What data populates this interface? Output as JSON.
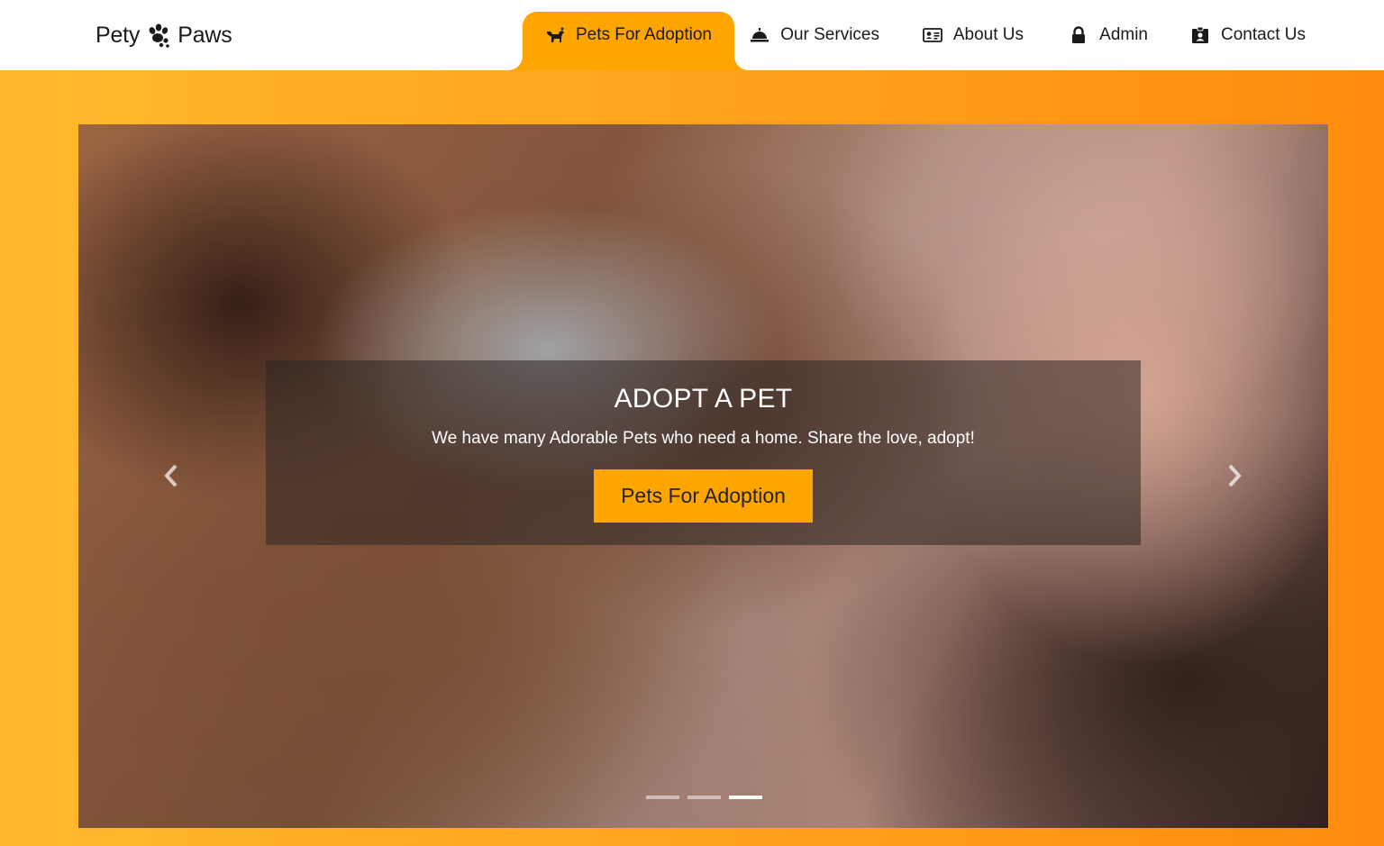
{
  "brand": {
    "name_left": "Pety",
    "name_right": "Paws",
    "icon": "paw-icon"
  },
  "nav": {
    "items": [
      {
        "label": "Pets For Adoption",
        "icon": "dog-icon",
        "active": true
      },
      {
        "label": "Our Services",
        "icon": "service-bell-icon",
        "active": false
      },
      {
        "label": "About Us",
        "icon": "id-card-icon",
        "active": false
      },
      {
        "label": "Admin",
        "icon": "lock-icon",
        "active": false
      },
      {
        "label": "Contact Us",
        "icon": "id-badge-icon",
        "active": false
      }
    ]
  },
  "hero": {
    "title": "ADOPT A PET",
    "subtitle": "We have many Adorable Pets who need a home. Share the love, adopt!",
    "cta_label": "Pets For Adoption",
    "slides_total": 3,
    "active_slide": 3,
    "prev_icon": "chevron-left-icon",
    "next_icon": "chevron-right-icon"
  },
  "colors": {
    "accent": "#ffa500",
    "gradient_start": "#ffb92e",
    "gradient_end": "#ff8c10"
  }
}
